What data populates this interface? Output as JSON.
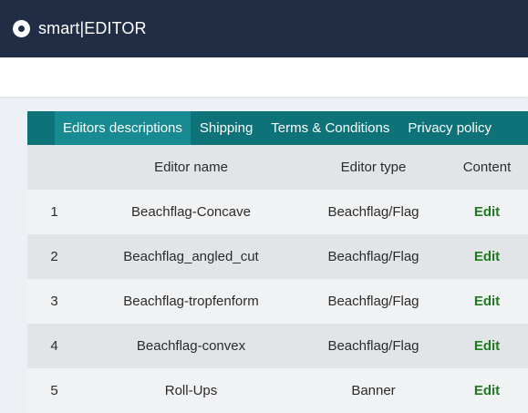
{
  "app": {
    "title": "smart|EDITOR",
    "logo_icon": "target-icon"
  },
  "tabs": [
    {
      "label": "Editors descriptions",
      "active": true
    },
    {
      "label": "Shipping",
      "active": false
    },
    {
      "label": "Terms & Conditions",
      "active": false
    },
    {
      "label": "Privacy policy",
      "active": false
    }
  ],
  "table": {
    "headers": [
      "",
      "Editor name",
      "Editor type",
      "Content"
    ],
    "rows": [
      {
        "index": "1",
        "name": "Beachflag-Concave",
        "type": "Beachflag/Flag",
        "action": "Edit"
      },
      {
        "index": "2",
        "name": "Beachflag_angled_cut",
        "type": "Beachflag/Flag",
        "action": "Edit"
      },
      {
        "index": "3",
        "name": "Beachflag-tropfenform",
        "type": "Beachflag/Flag",
        "action": "Edit"
      },
      {
        "index": "4",
        "name": "Beachflag-convex",
        "type": "Beachflag/Flag",
        "action": "Edit"
      },
      {
        "index": "5",
        "name": "Roll-Ups",
        "type": "Banner",
        "action": "Edit"
      }
    ]
  },
  "colors": {
    "topbar": "#212d45",
    "tabbar": "#0e7279",
    "tab_active": "#178a92",
    "edit_link": "#1e7a1e"
  }
}
